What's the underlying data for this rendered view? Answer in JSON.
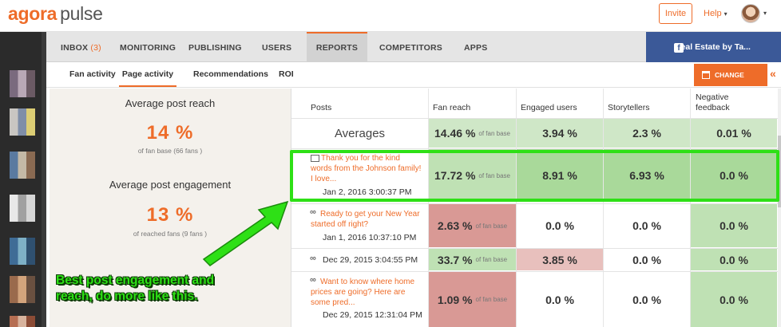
{
  "header": {
    "logo_part1": "agora",
    "logo_part2": "pulse",
    "invite_label": "Invite",
    "help_label": "Help",
    "caret": "▾"
  },
  "nav": {
    "inbox_label": "INBOX",
    "inbox_count": "(3)",
    "monitoring_label": "MONITORING",
    "publishing_label": "PUBLISHING",
    "users_label": "USERS",
    "reports_label": "REPORTS",
    "competitors_label": "COMPETITORS",
    "apps_label": "APPS",
    "page_tab_label": "Real Estate by Ta...",
    "fb_glyph": "f"
  },
  "subnav": {
    "fan_activity": "Fan activity",
    "page_activity": "Page activity",
    "recommendations": "Recommendations",
    "roi": "ROI",
    "change_dates": "CHANGE DATES",
    "collapse": "«"
  },
  "stats": {
    "reach_title": "Average post reach",
    "reach_value": "14 %",
    "reach_sub": "of fan base (66 fans )",
    "engagement_title": "Average post engagement",
    "engagement_value": "13 %",
    "engagement_sub": "of reached fans (9 fans )"
  },
  "table": {
    "headers": {
      "posts": "Posts",
      "fan_reach": "Fan reach",
      "engaged_users": "Engaged users",
      "storytellers": "Storytellers",
      "negative_feedback_1": "Negative",
      "negative_feedback_2": "feedback"
    },
    "unit_label": "of fan base",
    "averages": {
      "label": "Averages",
      "fan_reach": "14.46 %",
      "engaged_users": "3.94 %",
      "storytellers": "2.3 %",
      "negative": "0.01 %"
    },
    "rows": [
      {
        "text_1": "Thank you for the kind",
        "text_2": "words from the Johnson family!",
        "text_3": "I love...",
        "date": "Jan 2, 2016 3:00:37 PM",
        "fan_reach": "17.72 %",
        "engaged_users": "8.91 %",
        "storytellers": "6.93 %",
        "negative": "0.0 %"
      },
      {
        "text_1": "Ready to get your New Year",
        "text_2": "started off right?",
        "date": "Jan 1, 2016 10:37:10 PM",
        "fan_reach": "2.63 %",
        "engaged_users": "0.0 %",
        "storytellers": "0.0 %",
        "negative": "0.0 %"
      },
      {
        "date": "Dec 29, 2015 3:04:55 PM",
        "fan_reach": "33.7 %",
        "engaged_users": "3.85 %",
        "storytellers": "0.0 %",
        "negative": "0.0 %"
      },
      {
        "text_1": "Want to know where home",
        "text_2": "prices are going? Here are",
        "text_3": "some pred...",
        "date": "Dec 29, 2015 12:31:04 PM",
        "fan_reach": "1.09 %",
        "engaged_users": "0.0 %",
        "storytellers": "0.0 %",
        "negative": "0.0 %"
      }
    ]
  },
  "annotation": {
    "line_1": "Best post engagement and",
    "line_2": "reach, do more like this."
  },
  "colors": {
    "brand_orange": "#ee6c29",
    "facebook_blue": "#3b5998",
    "highlight_green": "#2ee016"
  }
}
